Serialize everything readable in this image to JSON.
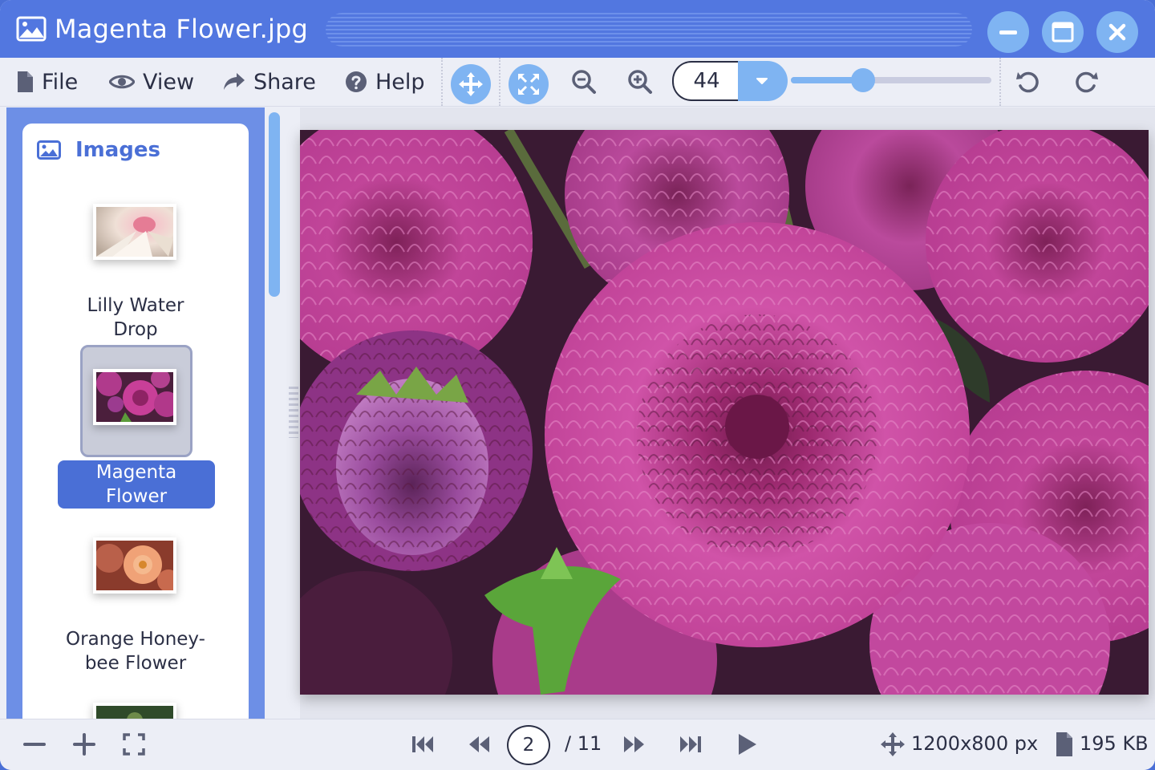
{
  "window": {
    "title": "Magenta Flower.jpg",
    "accent_color": "#5277e0",
    "button_color": "#7fb4f2",
    "controls": [
      "minimize-icon",
      "maximize-icon",
      "close-icon"
    ]
  },
  "menu": {
    "file": "File",
    "view": "View",
    "share": "Share",
    "help": "Help"
  },
  "toolbar": {
    "tools": [
      "move-icon",
      "fit-to-screen-icon",
      "zoom-out-icon",
      "zoom-in-icon"
    ],
    "zoom_value": "44",
    "zoom_slider_fraction": 0.36,
    "history": [
      "undo-icon",
      "redo-icon"
    ]
  },
  "sidebar": {
    "header": "Images",
    "items": [
      {
        "label": "Lilly Water Drop",
        "line1": "Lilly Water",
        "line2": "Drop",
        "selected": false
      },
      {
        "label": "Magenta Flower",
        "line1": "Magenta",
        "line2": "Flower",
        "selected": true
      },
      {
        "label": "Orange Honey-bee Flower",
        "line1": "Orange Honey-",
        "line2": "bee Flower",
        "selected": false
      }
    ]
  },
  "status": {
    "current_page": "2",
    "total_pages": "/ 11",
    "dimensions": "1200x800 px",
    "file_size": "195 KB"
  }
}
